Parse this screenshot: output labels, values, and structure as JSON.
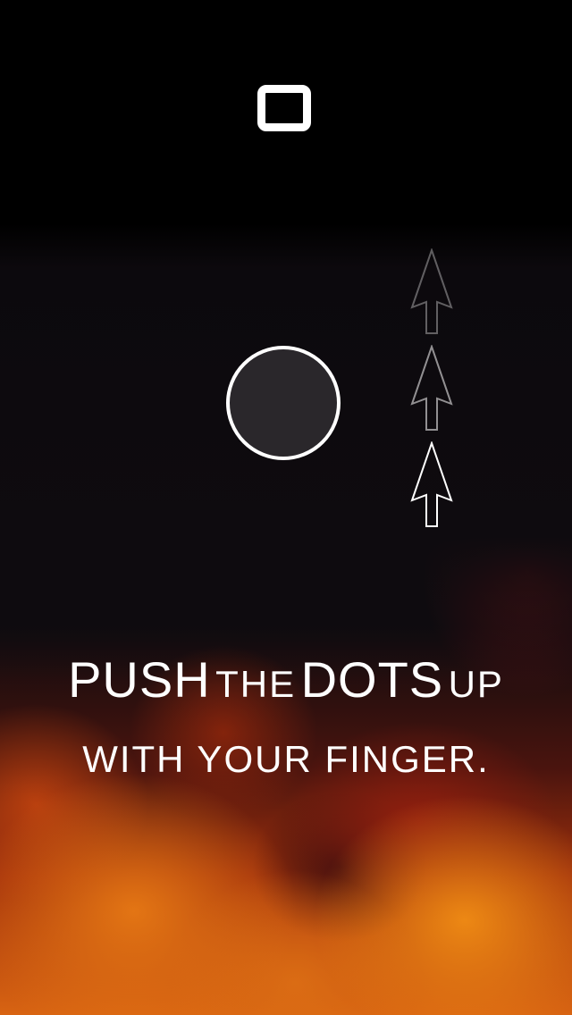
{
  "controls": {
    "stop_icon": "stop-square-icon"
  },
  "game": {
    "dot_color": "#2a272b",
    "arrows": [
      {
        "icon": "up-arrow-icon",
        "opacity": 0.35
      },
      {
        "icon": "up-arrow-icon",
        "opacity": 0.55
      },
      {
        "icon": "up-arrow-icon",
        "opacity": 1.0
      }
    ]
  },
  "instructions": {
    "line1": {
      "word1": "PUSH",
      "word2": "THE",
      "word3": "DOTS",
      "word4": "UP"
    },
    "line2": "WITH YOUR FINGER."
  },
  "colors": {
    "accent": "#ffffff",
    "fire_light": "#e8830f",
    "fire_dark": "#a0300c"
  }
}
